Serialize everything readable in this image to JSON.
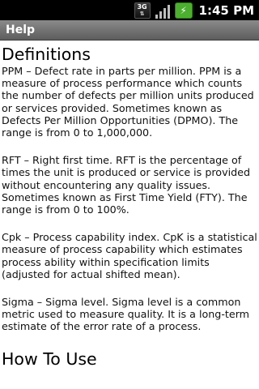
{
  "status_bar": {
    "network_label": "3G",
    "time": "1:45 PM",
    "icons": [
      "3g-data-icon",
      "signal-strength-icon",
      "battery-charging-icon"
    ]
  },
  "app_bar": {
    "title": "Help"
  },
  "content": {
    "heading": "Definitions",
    "definitions": [
      "PPM – Defect rate in parts per million. PPM is a measure of process performance which counts the number of defects per million units produced or services provided. Sometimes known as Defects Per Million Opportunities (DPMO). The range is from 0 to 1,000,000.",
      "RFT – Right first time. RFT is the percentage of times the unit is produced or service is provided without encountering any quality issues. Sometimes known as First Time Yield (FTY). The range is from 0 to 100%.",
      "Cpk – Process capability index. CpK is a statistical measure of process capability which estimates process ability within specification limits (adjusted for actual shifted mean).",
      "Sigma – Sigma level. Sigma level is a common metric used to measure quality. It is a long-term estimate of the error rate of a process."
    ],
    "next_heading": "How To Use"
  },
  "colors": {
    "status_bar_bg": "#000000",
    "title_bar_bg": "#6f6f6f",
    "battery_green": "#4caf2f",
    "page_bg": "#ffffff"
  }
}
